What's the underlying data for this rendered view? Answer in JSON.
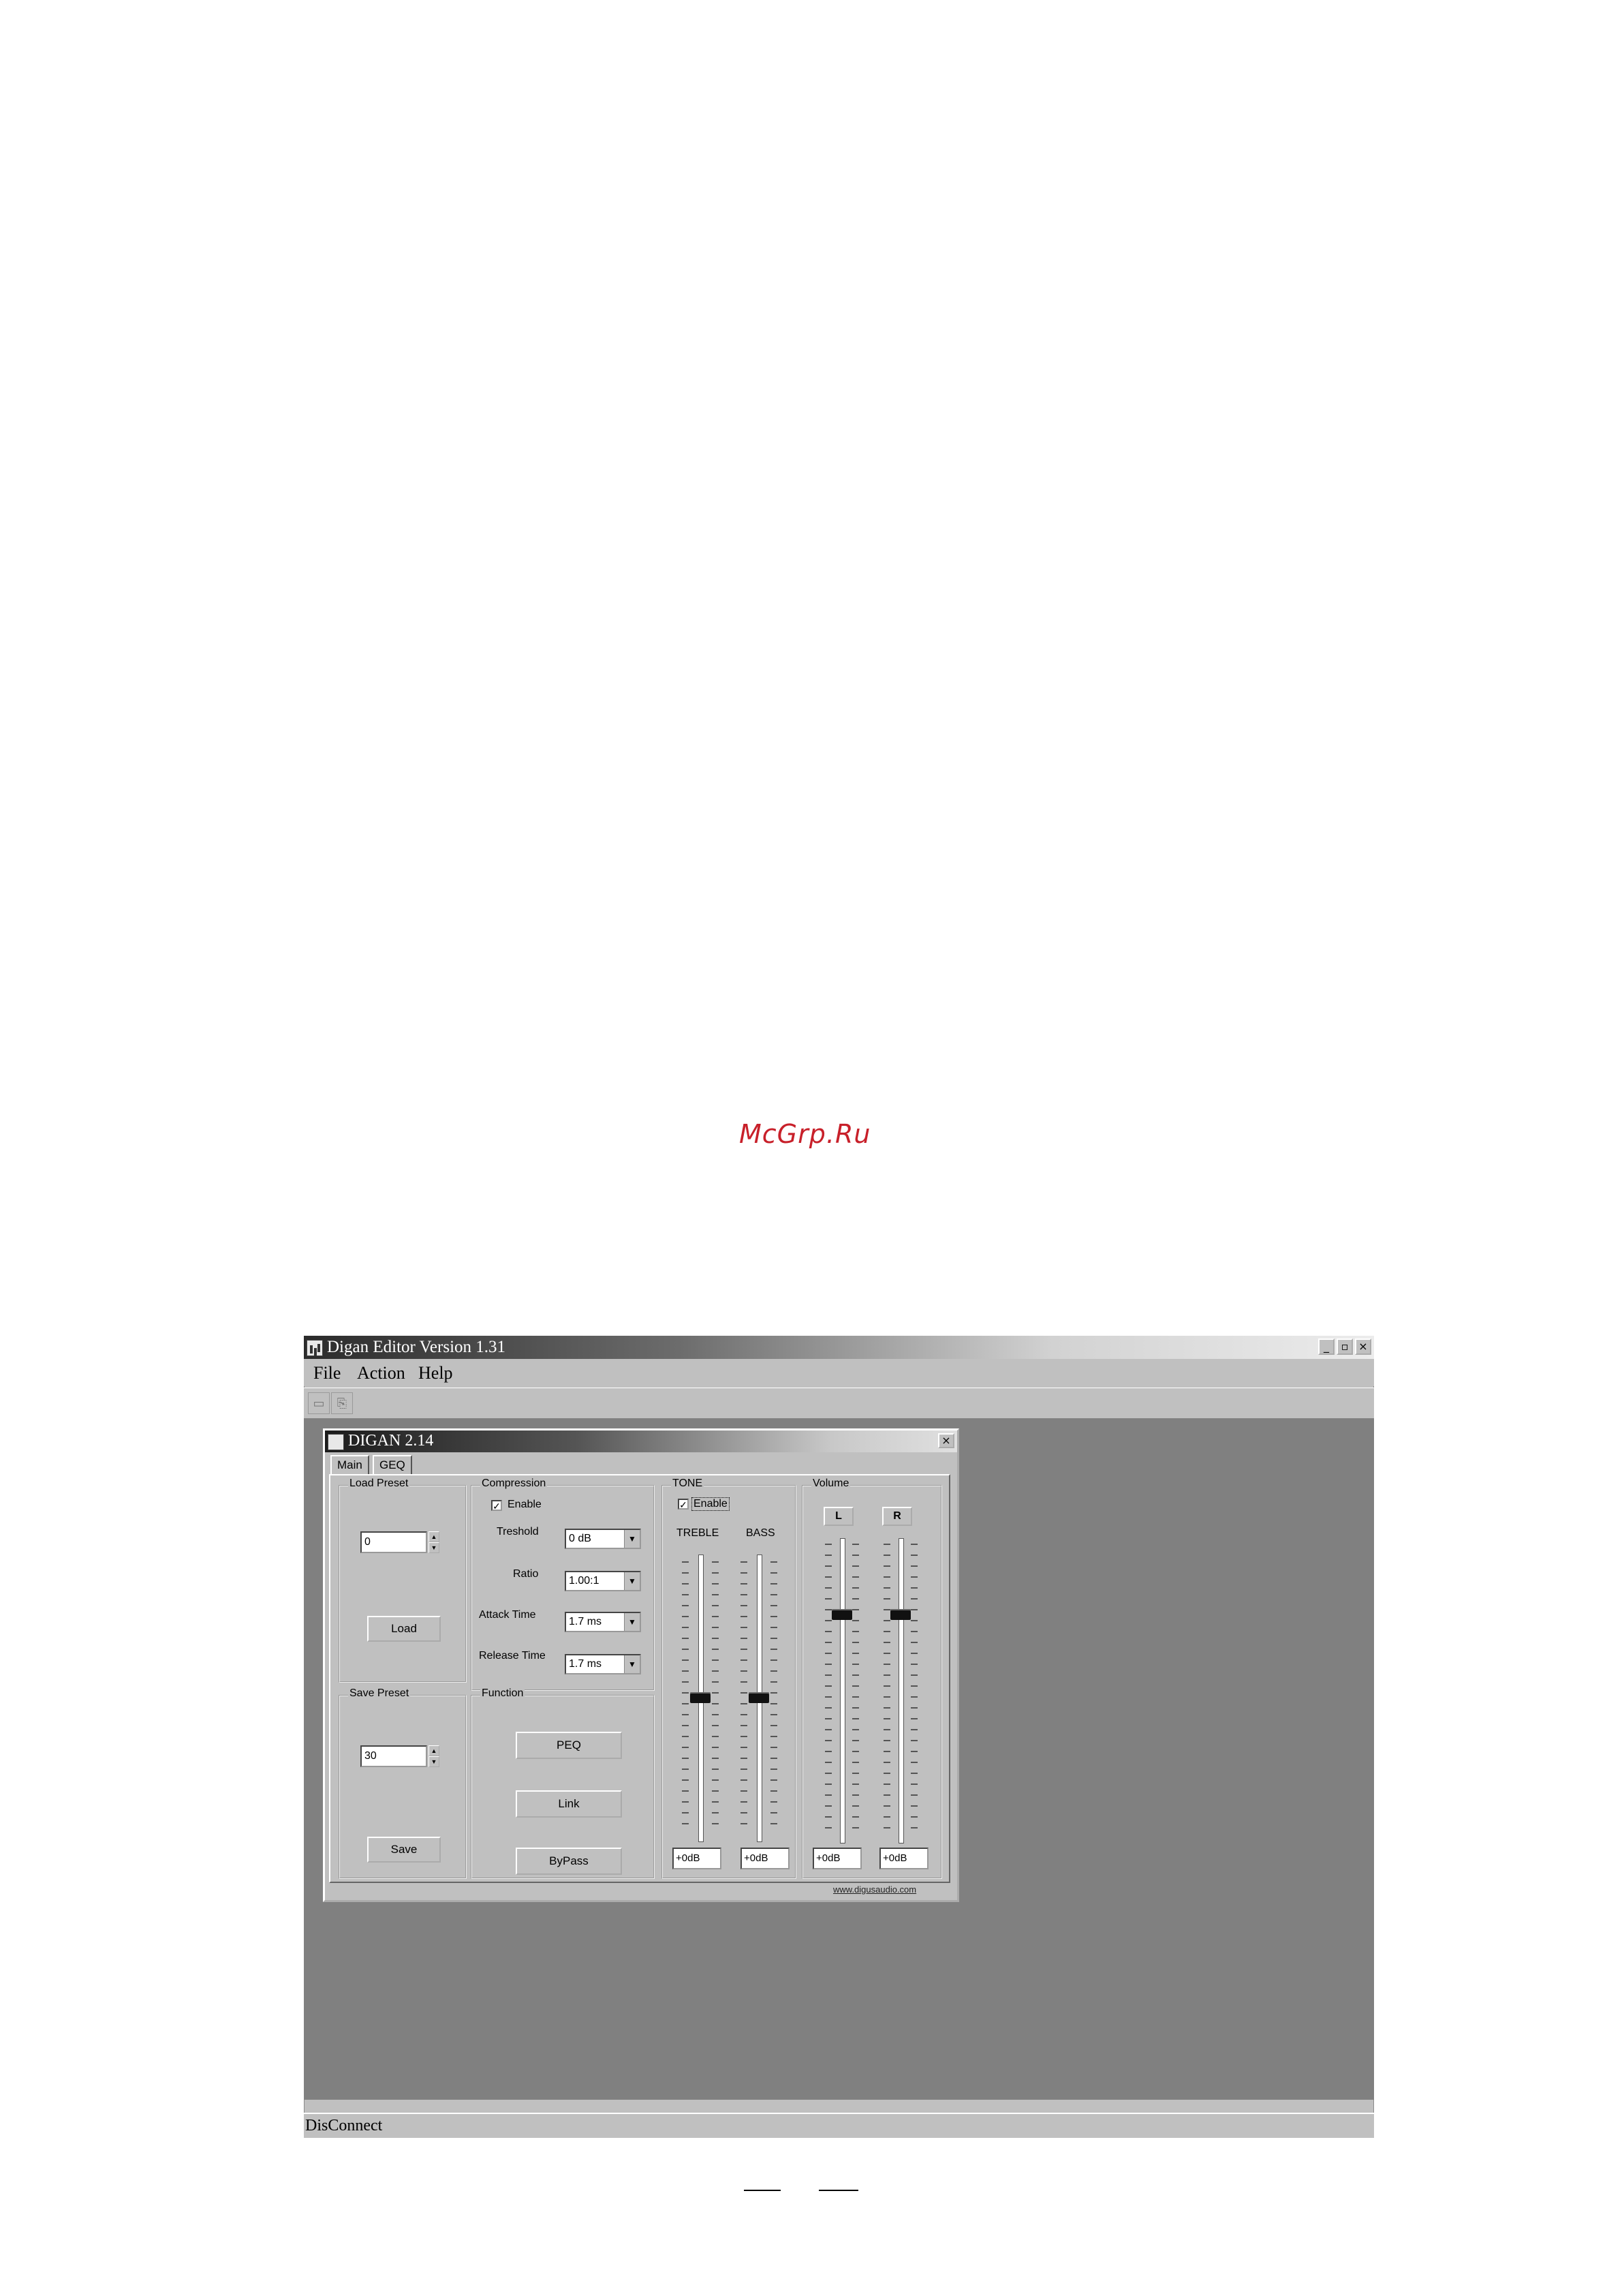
{
  "watermark": "McGrp.Ru",
  "app": {
    "title": "Digan Editor Version  1.31",
    "window_buttons": [
      "_",
      "▫",
      "×"
    ],
    "menu": [
      "File",
      "Action",
      "Help"
    ],
    "status": "DisConnect"
  },
  "child": {
    "title": "DIGAN 2.14",
    "close": "×",
    "tabs": [
      "Main",
      "GEQ"
    ],
    "load_preset": {
      "label": "Load Preset",
      "value": "0",
      "button": "Load"
    },
    "save_preset": {
      "label": "Save Preset",
      "value": "30",
      "button": "Save"
    },
    "compression": {
      "label": "Compression",
      "enable_label": "Enable",
      "enabled": true,
      "threshold": {
        "label": "Treshold",
        "value": "0    dB"
      },
      "ratio": {
        "label": "Ratio",
        "value": "1.00:1"
      },
      "attack": {
        "label": "Attack Time",
        "value": "1.7 ms"
      },
      "release": {
        "label": "Release Time",
        "value": "1.7 ms"
      }
    },
    "function": {
      "label": "Function",
      "buttons": [
        "PEQ",
        "Link",
        "ByPass"
      ]
    },
    "tone": {
      "label": "TONE",
      "enable_label": "Enable",
      "enabled": true,
      "treble": {
        "label": "TREBLE",
        "value": "+0dB",
        "level": 0.5
      },
      "bass": {
        "label": "BASS",
        "value": "+0dB",
        "level": 0.5
      }
    },
    "volume": {
      "label": "Volume",
      "left": {
        "label": "L",
        "value": "+0dB",
        "level": 0.25
      },
      "right": {
        "label": "R",
        "value": "+0dB",
        "level": 0.25
      }
    },
    "link": "www.digusaudio.com"
  }
}
